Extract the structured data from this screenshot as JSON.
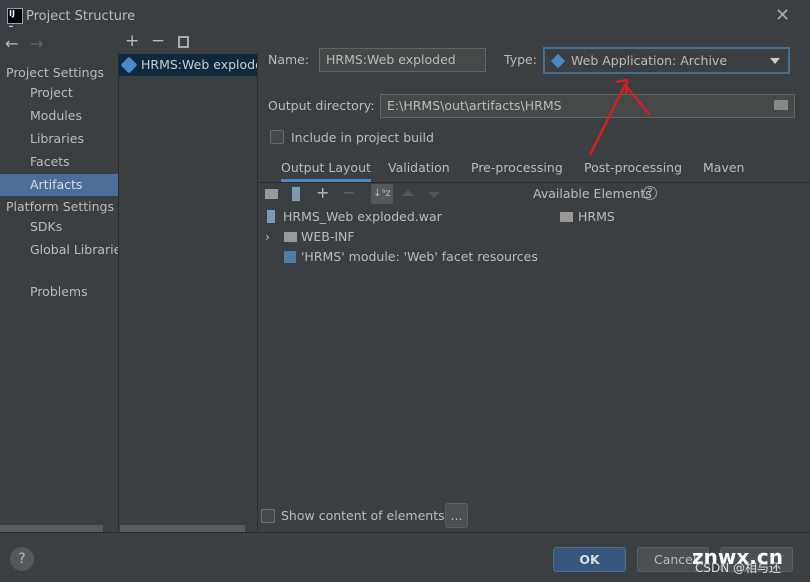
{
  "window": {
    "title": "Project Structure",
    "close": "✕"
  },
  "nav": {
    "back": "←",
    "forward": "→"
  },
  "sidebar": {
    "project_settings": "Project Settings",
    "items": [
      "Project",
      "Modules",
      "Libraries",
      "Facets",
      "Artifacts"
    ],
    "selected": "Artifacts",
    "platform_settings": "Platform Settings",
    "platform_items": [
      "SDKs",
      "Global Libraries"
    ],
    "problems": "Problems"
  },
  "artifacts": {
    "toolbar": [
      "+",
      "−"
    ],
    "items": [
      "HRMS:Web exploded"
    ]
  },
  "form": {
    "name_label": "Name:",
    "name_value": "HRMS:Web exploded",
    "type_label": "Type:",
    "type_value": "Web Application: Archive",
    "output_label": "Output directory:",
    "output_value": "E:\\HRMS\\out\\artifacts\\HRMS",
    "include_label": "Include in project build",
    "include_checked": false
  },
  "tabs": [
    "Output Layout",
    "Validation",
    "Pre-processing",
    "Post-processing",
    "Maven"
  ],
  "active_tab": "Output Layout",
  "layout_tree": [
    "HRMS_Web exploded.war",
    "WEB-INF",
    "'HRMS' module: 'Web' facet resources"
  ],
  "available": {
    "label": "Available Elements",
    "help": "?",
    "items": [
      "HRMS"
    ]
  },
  "show_content": {
    "label": "Show content of elements",
    "checked": false,
    "more": "..."
  },
  "footer": {
    "help": "?",
    "ok": "OK",
    "cancel": "Cancel"
  },
  "watermark": {
    "site": "znwx.cn",
    "author": "CSDN @相与还"
  },
  "colors": {
    "accent": "#365880",
    "selection": "#0d293e",
    "annotation_arrow": "#d42020"
  }
}
